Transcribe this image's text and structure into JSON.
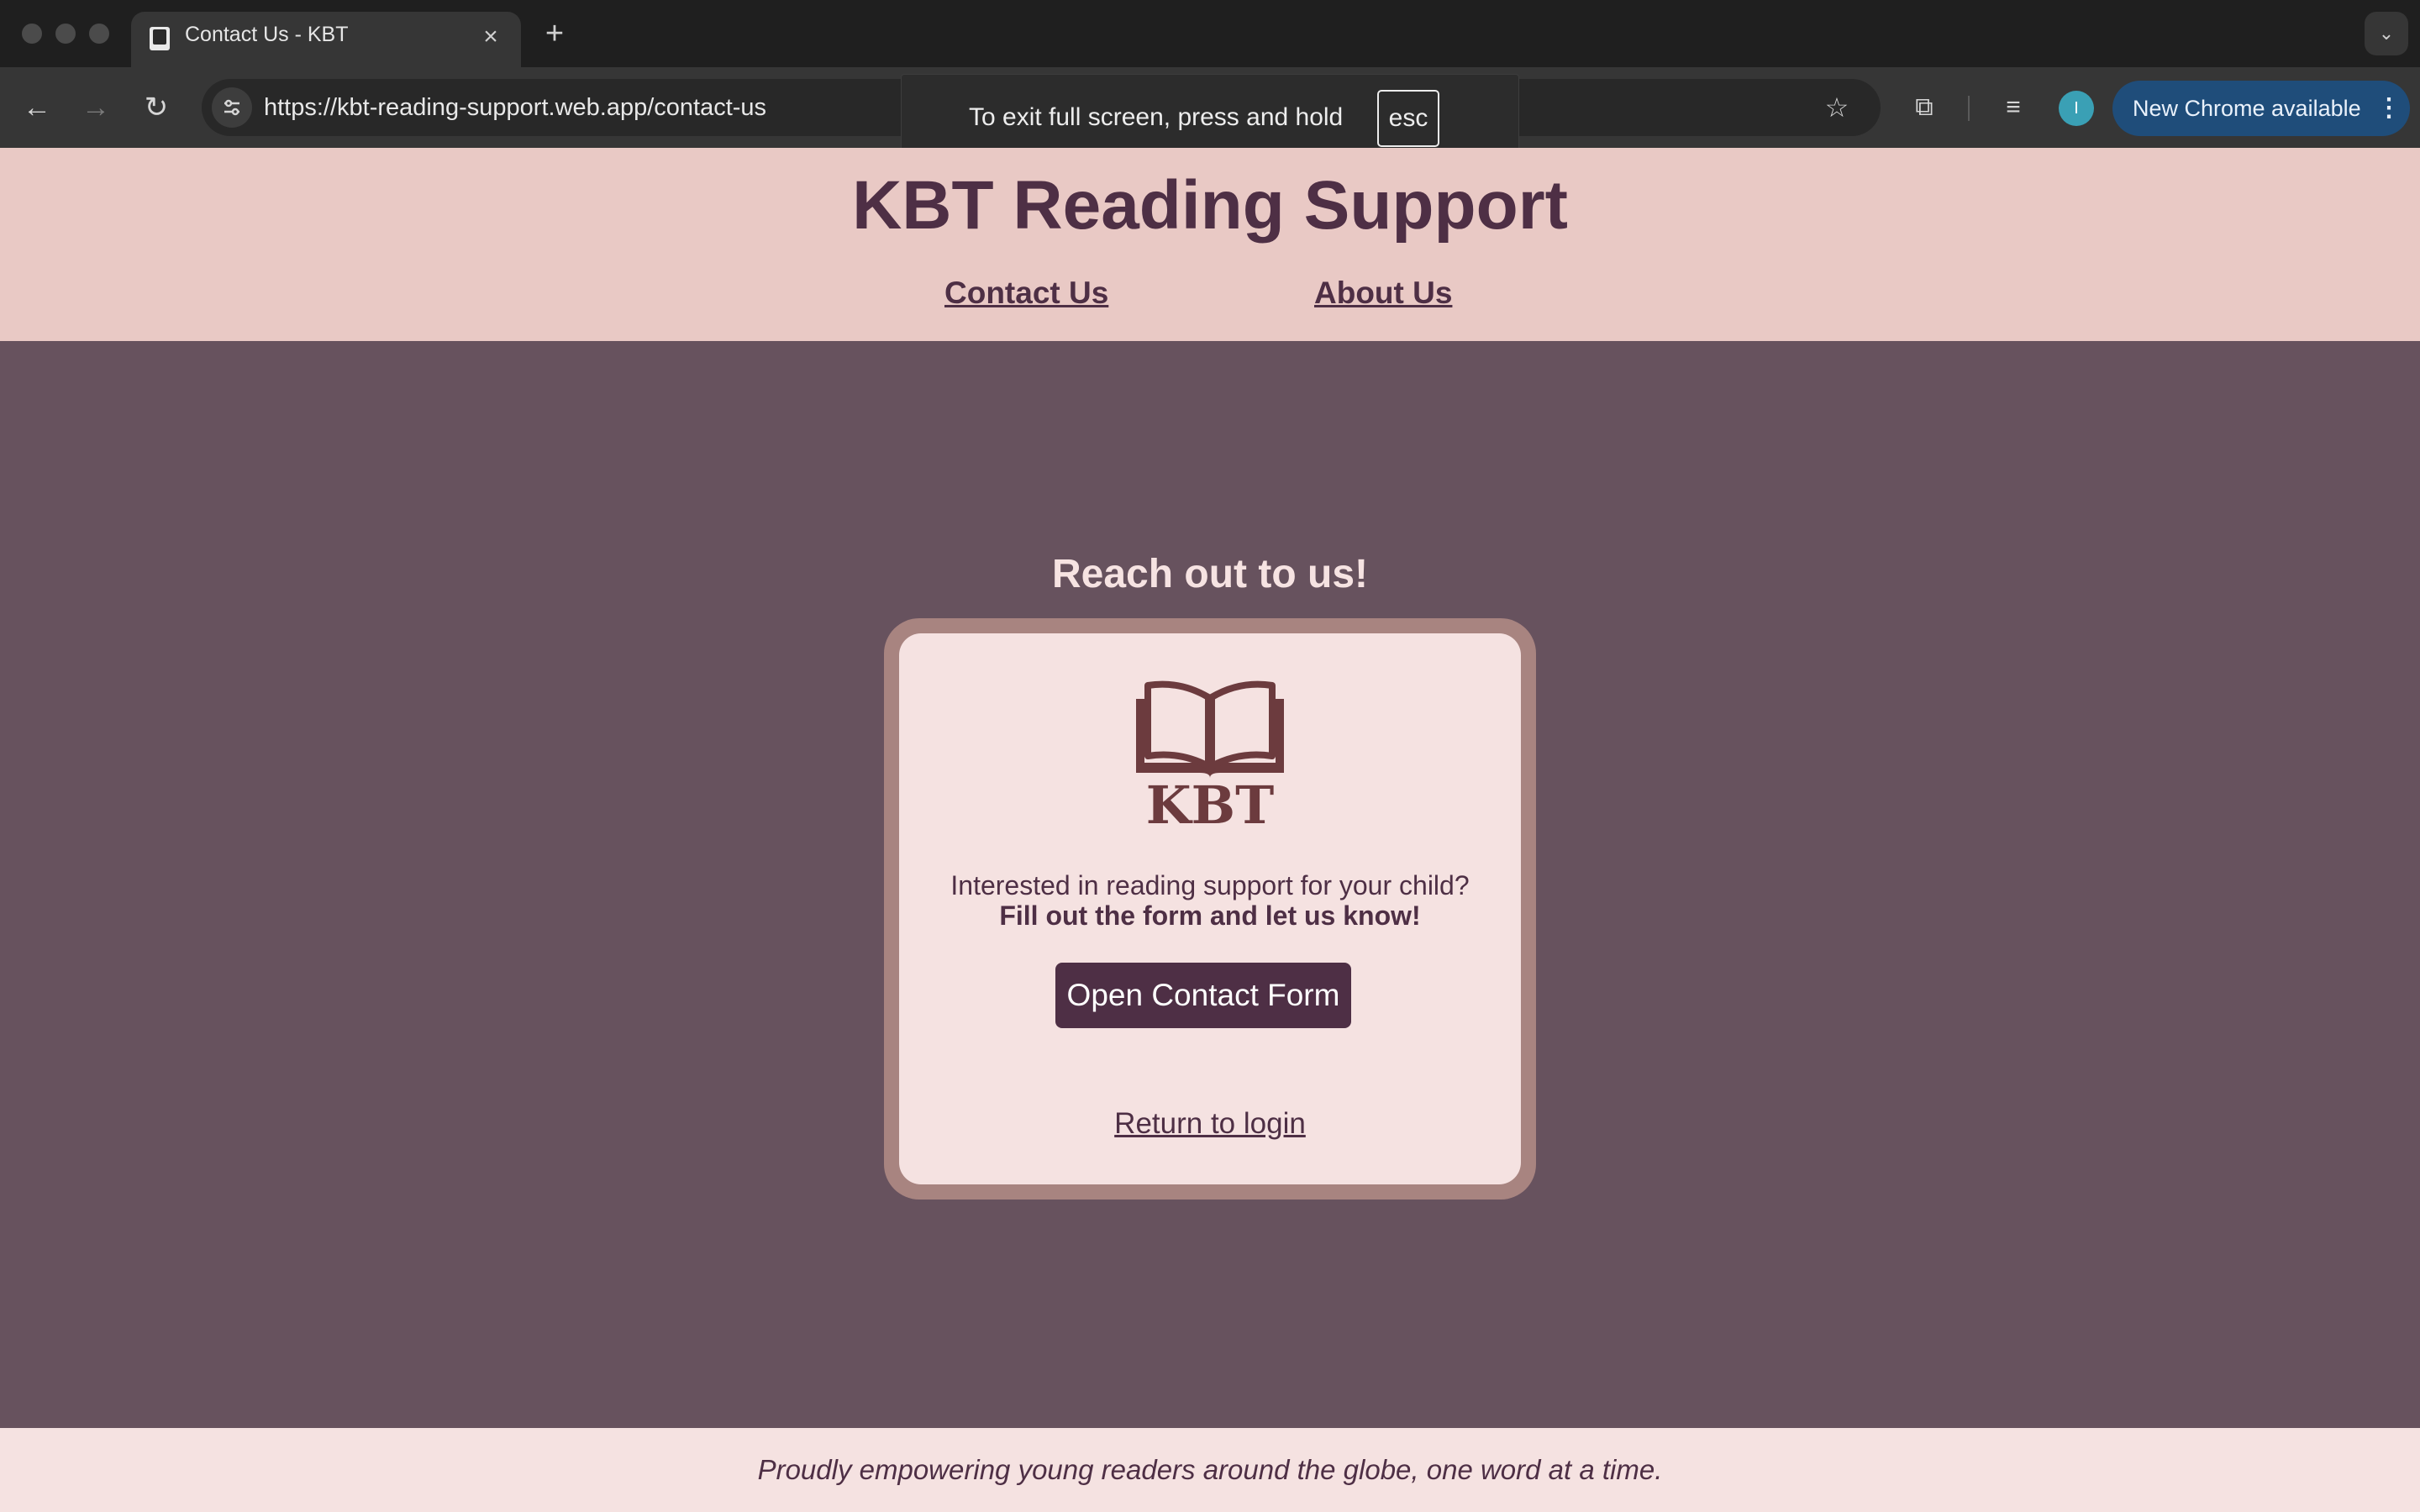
{
  "browser": {
    "tab": {
      "title": "Contact Us - KBT",
      "favicon": "book-icon",
      "close_icon": "close-icon"
    },
    "new_tab_icon": "plus-icon",
    "tab_search_icon": "chevron-down-icon",
    "nav": {
      "back_icon": "arrow-left-icon",
      "forward_icon": "arrow-right-icon",
      "reload_icon": "reload-icon"
    },
    "omnibox": {
      "url": "https://kbt-reading-support.web.app/contact-us",
      "site_info_icon": "tune-icon",
      "bookmark_icon": "star-icon"
    },
    "toolbar_icons": [
      "extensions-icon",
      "media-controls-icon"
    ],
    "profile_initial": "I",
    "update_button": {
      "label": "New Chrome available",
      "menu_icon": "more-vert-icon",
      "color": "#1f4d7a"
    },
    "fullscreen_toast": {
      "message": "To exit full screen, press and hold",
      "key": "esc"
    }
  },
  "site": {
    "title": "KBT Reading Support",
    "nav": [
      {
        "label": "Contact Us"
      },
      {
        "label": "About Us"
      }
    ],
    "colors": {
      "header_bg": "#e9c9c5",
      "main_bg": "#67525e",
      "accent": "#4e2f45",
      "card_bg": "#f5e2e1"
    }
  },
  "main": {
    "heading": "Reach out to us!",
    "card": {
      "logo_text": "KBT",
      "logo_icon": "open-book-icon",
      "line1": "Interested in reading support for your child?",
      "line2": "Fill out the form and let us know!",
      "button_label": "Open Contact Form",
      "return_link": "Return to login"
    }
  },
  "footer": {
    "text": "Proudly empowering young readers around the globe, one word at a time."
  }
}
